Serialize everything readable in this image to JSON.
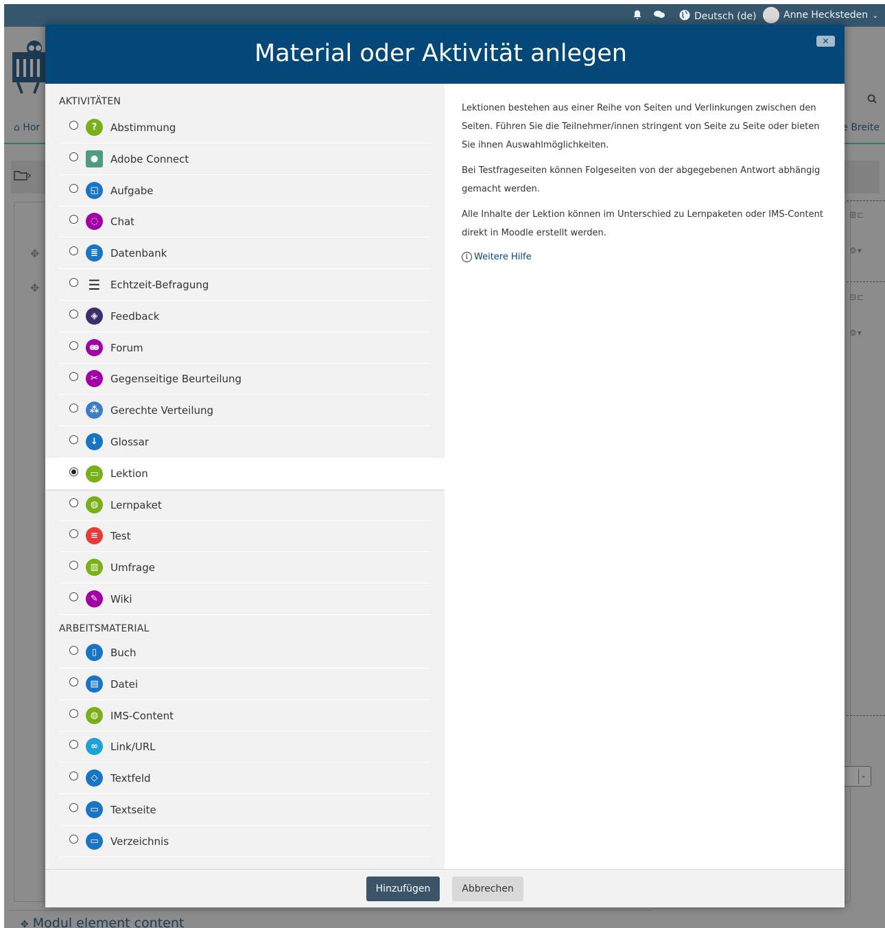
{
  "topbar": {
    "language": "Deutsch (de)",
    "user": "Anne Hecksteden"
  },
  "page": {
    "home_label": "Hor",
    "wide_label": "e Breite",
    "module_title": "Modul element content"
  },
  "modal": {
    "title": "Material oder Aktivität anlegen",
    "close_label": "✕",
    "activities_heading": "AKTIVITÄTEN",
    "resources_heading": "ARBEITSMATERIAL",
    "activities": [
      {
        "label": "Abstimmung",
        "icon": "question-icon",
        "color": "#79b018"
      },
      {
        "label": "Adobe Connect",
        "icon": "person-icon",
        "color": "#4e9b7f"
      },
      {
        "label": "Aufgabe",
        "icon": "assignment-icon",
        "color": "#1874c5"
      },
      {
        "label": "Chat",
        "icon": "chat-icon",
        "color": "#a200a6"
      },
      {
        "label": "Datenbank",
        "icon": "database-icon",
        "color": "#1874c5"
      },
      {
        "label": "Echtzeit-Befragung",
        "icon": "list-icon",
        "color": "#222222"
      },
      {
        "label": "Feedback",
        "icon": "feedback-icon",
        "color": "#3b2e70"
      },
      {
        "label": "Forum",
        "icon": "forum-icon",
        "color": "#a200a6"
      },
      {
        "label": "Gegenseitige Beurteilung",
        "icon": "tools-icon",
        "color": "#a200a6"
      },
      {
        "label": "Gerechte Verteilung",
        "icon": "distribution-icon",
        "color": "#3a7dc9"
      },
      {
        "label": "Glossar",
        "icon": "glossary-icon",
        "color": "#1874c5"
      },
      {
        "label": "Lektion",
        "icon": "lesson-icon",
        "color": "#79b018",
        "selected": true
      },
      {
        "label": "Lernpaket",
        "icon": "package-icon",
        "color": "#79b018"
      },
      {
        "label": "Test",
        "icon": "quiz-icon",
        "color": "#e8393a"
      },
      {
        "label": "Umfrage",
        "icon": "survey-icon",
        "color": "#79b018"
      },
      {
        "label": "Wiki",
        "icon": "wiki-icon",
        "color": "#a200a6"
      }
    ],
    "resources": [
      {
        "label": "Buch",
        "icon": "book-icon",
        "color": "#1874c5"
      },
      {
        "label": "Datei",
        "icon": "file-icon",
        "color": "#1874c5"
      },
      {
        "label": "IMS-Content",
        "icon": "ims-icon",
        "color": "#79b018"
      },
      {
        "label": "Link/URL",
        "icon": "link-icon",
        "color": "#1fa1d8"
      },
      {
        "label": "Textfeld",
        "icon": "label-icon",
        "color": "#1874c5"
      },
      {
        "label": "Textseite",
        "icon": "page-icon",
        "color": "#1874c5"
      },
      {
        "label": "Verzeichnis",
        "icon": "folder-icon",
        "color": "#1874c5"
      }
    ],
    "description": {
      "paragraphs": [
        "Lektionen bestehen aus einer Reihe von Seiten und Verlinkungen zwischen den Seiten. Führen Sie die Teilnehmer/innen stringent von Seite zu Seite oder bieten Sie ihnen Auswahlmöglichkeiten.",
        "Bei Testfrageseiten können Folgeseiten von der abgegebenen Antwort abhängig gemacht werden.",
        "Alle Inhalte der Lektion können im Unterschied zu Lernpaketen oder IMS-Content direkt in Moodle erstellt werden."
      ],
      "help_label": "Weitere Hilfe"
    },
    "add_button": "Hinzufügen",
    "cancel_button": "Abbrechen"
  }
}
